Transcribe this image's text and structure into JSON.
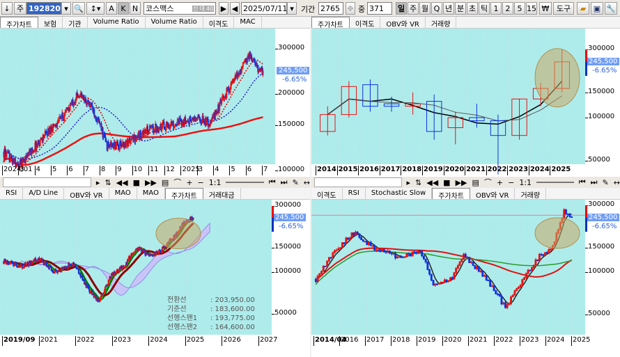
{
  "toolbar": {
    "code": "192820",
    "name": "코스맥스",
    "date": "2025/07/11",
    "period_label": "기간",
    "period": "2765",
    "count_label": "중",
    "count": "371",
    "letters": [
      "A",
      "K",
      "N"
    ],
    "badges": [
      "신",
      "대",
      "40"
    ],
    "intervals": [
      "일",
      "주",
      "월",
      "Q",
      "년",
      "분",
      "초",
      "틱",
      "1",
      "2",
      "5",
      "15"
    ],
    "won": "₩",
    "tools": "도구",
    "prefix": "주"
  },
  "price": "245,500",
  "change": "-6.65%",
  "panes": [
    {
      "id": "tl",
      "tabs": [
        "주가차트",
        "보험",
        "기관",
        "Volume Ratio",
        "Volume Ratio",
        "이격도",
        "MAC"
      ],
      "active": 0,
      "y_ticks": [
        "300000",
        "200000",
        "150000",
        "100000"
      ],
      "x_ticks": [
        "2024/01",
        "3",
        "4",
        "5",
        "6",
        "7",
        "8",
        "9",
        "10",
        "11",
        "12",
        "2025",
        "3",
        "4",
        "5",
        "6",
        "7"
      ]
    },
    {
      "id": "tr",
      "tabs": [
        "주가차트",
        "이격도",
        "OBV와 VR",
        "거래량"
      ],
      "active": 0,
      "y_ticks": [
        "300000",
        "150000",
        "100000",
        "50000"
      ],
      "x_ticks": [
        "2014",
        "2015",
        "2016",
        "2017",
        "2018",
        "2019",
        "2020",
        "2021",
        "2022",
        "2023",
        "2024",
        "2025"
      ]
    },
    {
      "id": "bl",
      "tabs": [
        "RSI",
        "A/D Line",
        "OBV와 VR",
        "MAO",
        "MAO",
        "주가차트",
        "거래대금"
      ],
      "active": 5,
      "y_ticks": [
        "300000",
        "150000",
        "100000",
        "50000"
      ],
      "x_ticks": [
        "2019/09",
        "2021",
        "2022",
        "2023",
        "2024",
        "2025",
        "2026",
        "2027"
      ],
      "ichimoku": [
        {
          "label": "전환선",
          "value": ": 203,950.00"
        },
        {
          "label": "기준선",
          "value": ": 183,600.00"
        },
        {
          "label": "선행스팬1",
          "value": ": 193,775.00"
        },
        {
          "label": "선행스팬2",
          "value": ": 164,600.00"
        }
      ]
    },
    {
      "id": "br",
      "tabs": [
        "이격도",
        "RSI",
        "Stochastic Slow",
        "주가차트",
        "OBV와 VR",
        "거래량"
      ],
      "active": 3,
      "y_ticks": [
        "300000",
        "150000",
        "100000",
        "50000"
      ],
      "x_ticks": [
        "2014/04",
        "2016",
        "2017",
        "2018",
        "2019",
        "2020",
        "2021",
        "2022",
        "2023",
        "2024",
        "2025"
      ]
    }
  ],
  "controls": {
    "zoom_ratio": "1:1"
  },
  "chart_data": [
    {
      "type": "candlestick",
      "pane": "tl",
      "interval": "daily",
      "bars": 365,
      "waypoints": [
        [
          0,
          118
        ],
        [
          20,
          104
        ],
        [
          40,
          120
        ],
        [
          65,
          145
        ],
        [
          85,
          165
        ],
        [
          105,
          200
        ],
        [
          125,
          175
        ],
        [
          145,
          125
        ],
        [
          165,
          125
        ],
        [
          185,
          135
        ],
        [
          205,
          145
        ],
        [
          225,
          150
        ],
        [
          250,
          155
        ],
        [
          275,
          160
        ],
        [
          290,
          152
        ],
        [
          310,
          195
        ],
        [
          330,
          240
        ],
        [
          345,
          285
        ],
        [
          355,
          255
        ],
        [
          364,
          245.5
        ]
      ],
      "unit": "thousand KRW",
      "ylim": [
        90000,
        320000
      ]
    },
    {
      "type": "candlestick",
      "pane": "tr",
      "interval": "yearly",
      "ohlc": [
        [
          80,
          120,
          75,
          105
        ],
        [
          105,
          180,
          100,
          165
        ],
        [
          170,
          185,
          110,
          120
        ],
        [
          125,
          140,
          110,
          120
        ],
        [
          120,
          150,
          105,
          125
        ],
        [
          130,
          145,
          70,
          80
        ],
        [
          85,
          110,
          65,
          100
        ],
        [
          100,
          125,
          85,
          95
        ],
        [
          95,
          105,
          40,
          75
        ],
        [
          75,
          135,
          70,
          135
        ],
        [
          135,
          175,
          120,
          160
        ],
        [
          160,
          300,
          150,
          245.5
        ]
      ],
      "unit": "thousand KRW",
      "ylim": [
        40000,
        320000
      ]
    },
    {
      "type": "candlestick",
      "pane": "bl",
      "interval": "weekly",
      "bars": 300,
      "waypoints": [
        [
          0,
          120
        ],
        [
          30,
          110
        ],
        [
          55,
          125
        ],
        [
          80,
          100
        ],
        [
          110,
          115
        ],
        [
          130,
          80
        ],
        [
          150,
          60
        ],
        [
          170,
          95
        ],
        [
          190,
          110
        ],
        [
          210,
          150
        ],
        [
          230,
          130
        ],
        [
          250,
          145
        ],
        [
          270,
          180
        ],
        [
          285,
          230
        ],
        [
          299,
          245.5
        ]
      ],
      "unit": "thousand KRW",
      "ylim": [
        40000,
        320000
      ]
    },
    {
      "type": "candlestick",
      "pane": "br",
      "interval": "monthly",
      "bars": 136,
      "waypoints": [
        [
          0,
          89
        ],
        [
          12,
          150
        ],
        [
          20,
          190
        ],
        [
          30,
          150
        ],
        [
          45,
          125
        ],
        [
          55,
          145
        ],
        [
          62,
          80
        ],
        [
          72,
          90
        ],
        [
          78,
          130
        ],
        [
          90,
          88
        ],
        [
          100,
          55
        ],
        [
          110,
          90
        ],
        [
          118,
          130
        ],
        [
          125,
          150
        ],
        [
          131,
          270
        ],
        [
          135,
          245.5
        ]
      ],
      "unit": "thousand KRW",
      "ylim": [
        40000,
        320000
      ]
    }
  ]
}
